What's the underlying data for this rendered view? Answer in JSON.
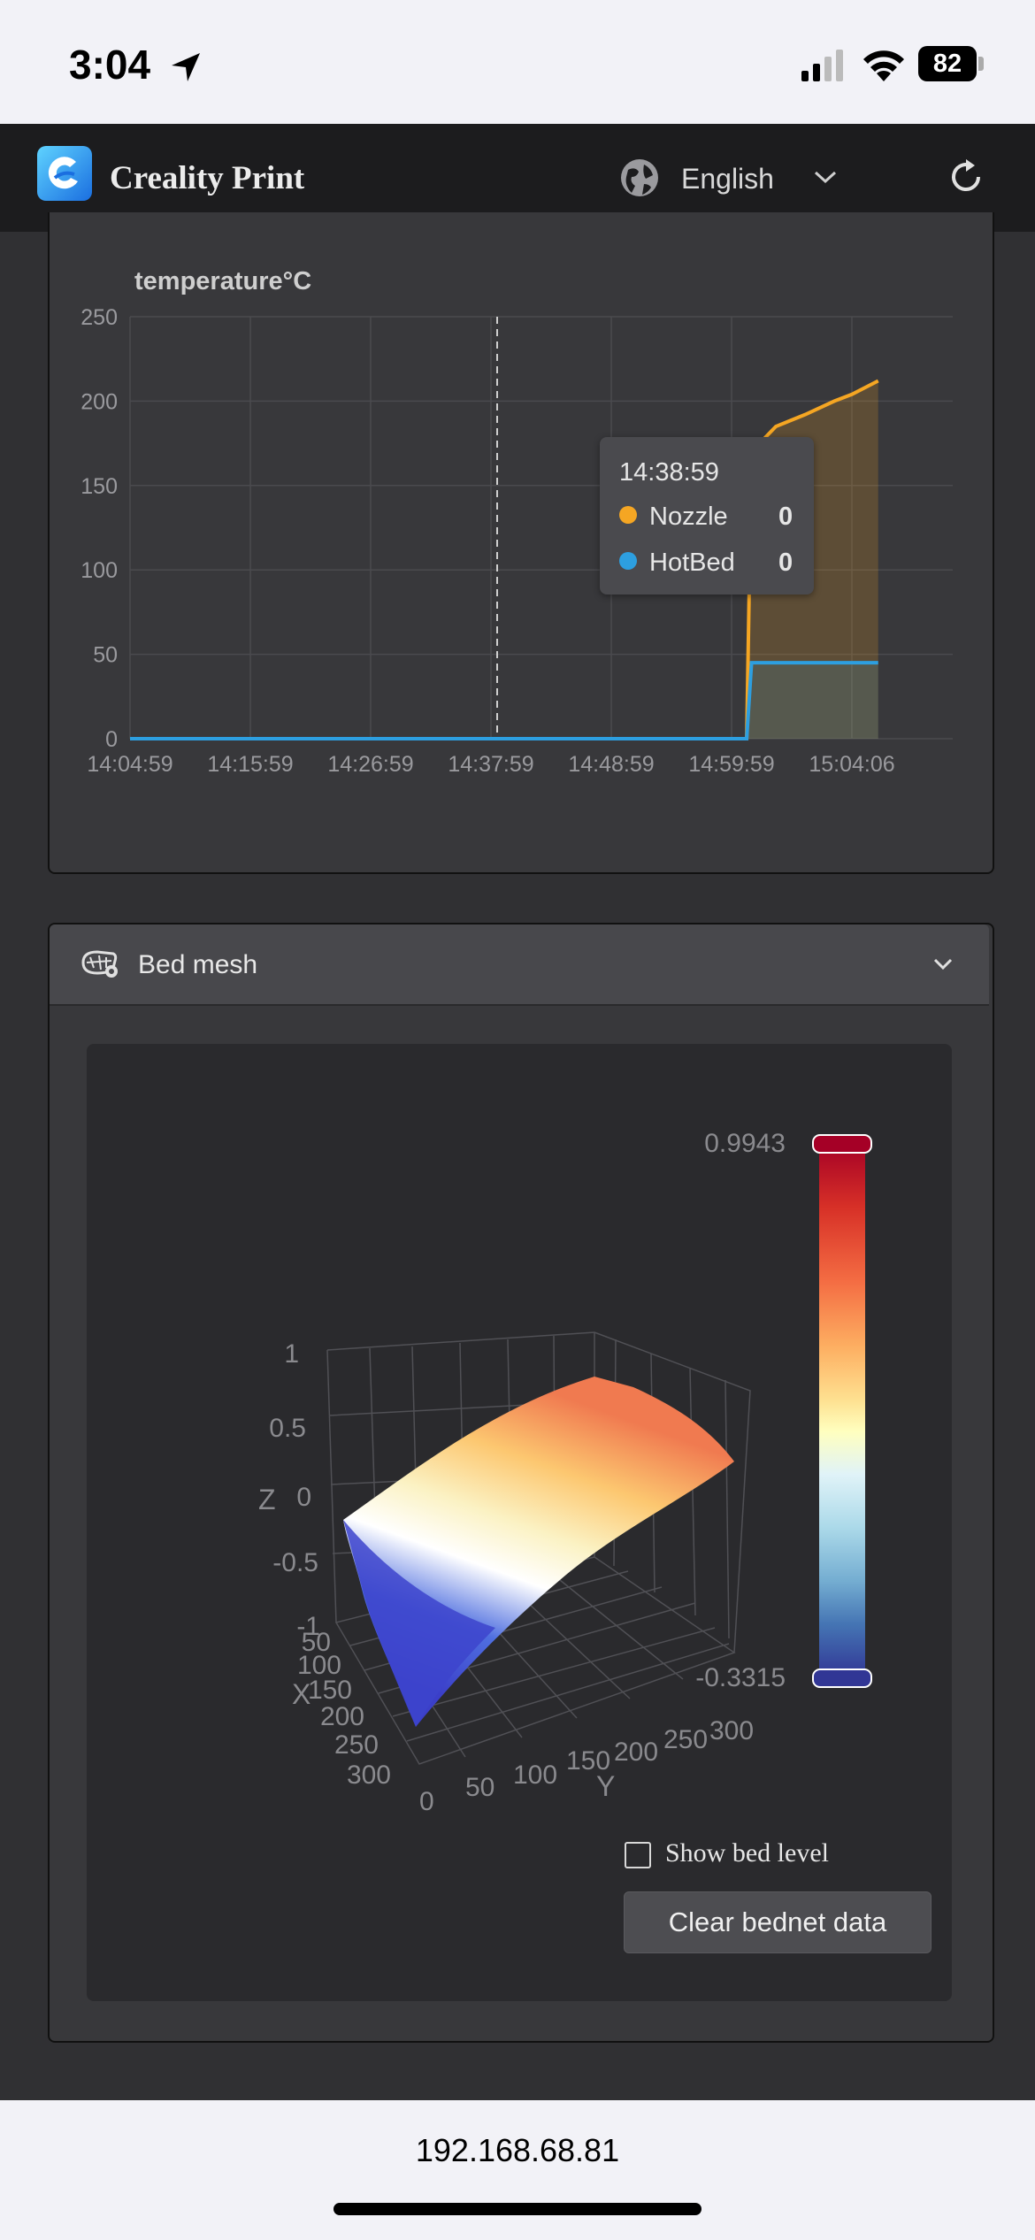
{
  "status_bar": {
    "time": "3:04",
    "battery": "82"
  },
  "header": {
    "app_title": "Creality Print",
    "language": "English",
    "icons": [
      "creality-logo-icon",
      "globe-icon",
      "chevron-down-icon",
      "refresh-icon"
    ]
  },
  "temperature_chart": {
    "title": "temperature°C",
    "tooltip": {
      "time": "14:38:59",
      "items": [
        {
          "label": "Nozzle",
          "value": "0",
          "color": "#f5a623"
        },
        {
          "label": "HotBed",
          "value": "0",
          "color": "#2d9fe0"
        }
      ]
    }
  },
  "bed_mesh": {
    "title": "Bed mesh",
    "colorbar_max": "0.9943",
    "colorbar_min": "-0.3315",
    "z_axis_label": "Z",
    "x_axis_label": "X",
    "y_axis_label": "Y",
    "z_ticks": [
      "1",
      "0.5",
      "0",
      "-0.5",
      "-1"
    ],
    "x_ticks": [
      "0",
      "50",
      "100",
      "150",
      "200",
      "250",
      "300"
    ],
    "y_ticks": [
      "0",
      "50",
      "100",
      "150",
      "200",
      "250",
      "300"
    ],
    "show_bed_level_label": "Show bed level",
    "clear_button_label": "Clear bednet data"
  },
  "browser": {
    "url": "192.168.68.81"
  },
  "colors": {
    "nozzle": "#f5a623",
    "hotbed": "#2d9fe0",
    "background": "#303033"
  },
  "chart_data": {
    "type": "area",
    "title": "temperature°C",
    "xlabel": "",
    "ylabel": "",
    "x_ticks": [
      "14:04:59",
      "14:15:59",
      "14:26:59",
      "14:37:59",
      "14:48:59",
      "14:59:59",
      "15:04:06"
    ],
    "ylim": [
      0,
      250
    ],
    "y_ticks": [
      0,
      50,
      100,
      150,
      200,
      250
    ],
    "grid": true,
    "legend": "tooltip",
    "series": [
      {
        "name": "Nozzle",
        "color": "#f5a623",
        "points": [
          [
            "14:04:59",
            0
          ],
          [
            "14:59:59",
            0
          ],
          [
            "15:00:30",
            0
          ],
          [
            "15:00:40",
            170
          ],
          [
            "15:01:30",
            185
          ],
          [
            "15:02:30",
            192
          ],
          [
            "15:03:30",
            200
          ],
          [
            "15:04:06",
            204
          ],
          [
            "15:05:00",
            212
          ]
        ]
      },
      {
        "name": "HotBed",
        "color": "#2d9fe0",
        "points": [
          [
            "14:04:59",
            0
          ],
          [
            "14:59:59",
            0
          ],
          [
            "15:00:30",
            0
          ],
          [
            "15:00:40",
            45
          ],
          [
            "15:05:00",
            45
          ]
        ]
      }
    ]
  }
}
